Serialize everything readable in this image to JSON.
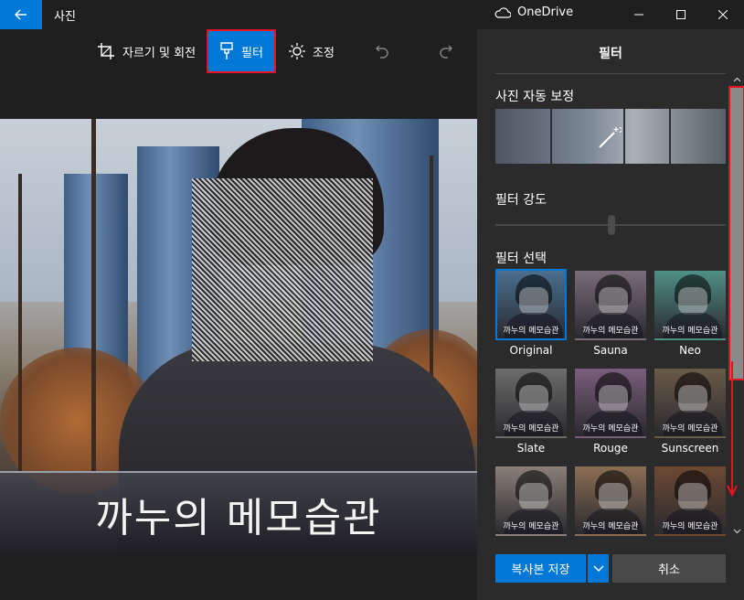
{
  "window": {
    "app_title": "사진",
    "cloud_label": "OneDrive"
  },
  "toolbar": {
    "crop_label": "자르기 및 회전",
    "filter_label": "필터",
    "adjust_label": "조정"
  },
  "photo": {
    "caption": "까누의 메모습관"
  },
  "panel": {
    "title": "필터",
    "auto_enhance_label": "사진 자동 보정",
    "filter_strength_label": "필터 강도",
    "filter_select_label": "필터 선택",
    "filter_strength_value": 0.5,
    "filters": [
      {
        "label": "Original",
        "selected": true,
        "tint": "#4a6f8f"
      },
      {
        "label": "Sauna",
        "selected": false,
        "tint": "#7a6c7a"
      },
      {
        "label": "Neo",
        "selected": false,
        "tint": "#4f8f86"
      },
      {
        "label": "Slate",
        "selected": false,
        "tint": "#6d6d6d"
      },
      {
        "label": "Rouge",
        "selected": false,
        "tint": "#7a5e7c"
      },
      {
        "label": "Sunscreen",
        "selected": false,
        "tint": "#6a5a48"
      },
      {
        "label": "",
        "selected": false,
        "tint": "#8a7f78"
      },
      {
        "label": "",
        "selected": false,
        "tint": "#8b6e55"
      },
      {
        "label": "",
        "selected": false,
        "tint": "#6c4a34"
      }
    ],
    "thumb_caption": "까누의 메모습관"
  },
  "actions": {
    "save_copy_label": "복사본 저장",
    "cancel_label": "취소"
  },
  "colors": {
    "accent": "#0078d7",
    "highlight": "#e81123"
  }
}
